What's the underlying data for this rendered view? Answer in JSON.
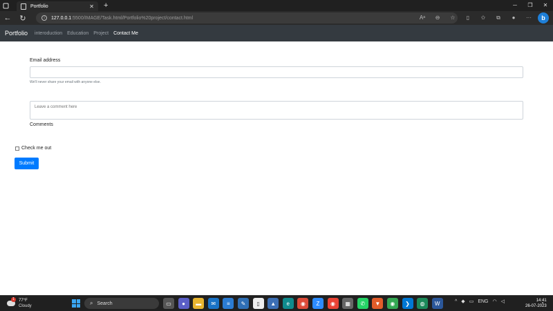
{
  "browser": {
    "tab_title": "Portfolio",
    "url_host": "127.0.0.1",
    "url_path": ":5500/IMAGE/Task.html/Portfolio%20project/contact.html"
  },
  "site": {
    "brand": "Portfolio",
    "nav": [
      {
        "label": "interoduction"
      },
      {
        "label": "Education"
      },
      {
        "label": "Project"
      },
      {
        "label": "Contact Me"
      }
    ]
  },
  "form": {
    "email_label": "Email address",
    "email_value": "",
    "email_help": "We'll never share your email with anyone else.",
    "comment_placeholder": "Leave a comment here",
    "comments_label": "Comments",
    "check_label": "Check me out",
    "submit_label": "Submit"
  },
  "taskbar": {
    "weather_temp": "77°F",
    "weather_cond": "Cloudy",
    "weather_badge": "1",
    "search_label": "Search",
    "lang": "ENG",
    "time": "14:41",
    "date": "26-07-2023"
  },
  "colors": {
    "navbar_bg": "#343a40",
    "submit_bg": "#007bff"
  }
}
